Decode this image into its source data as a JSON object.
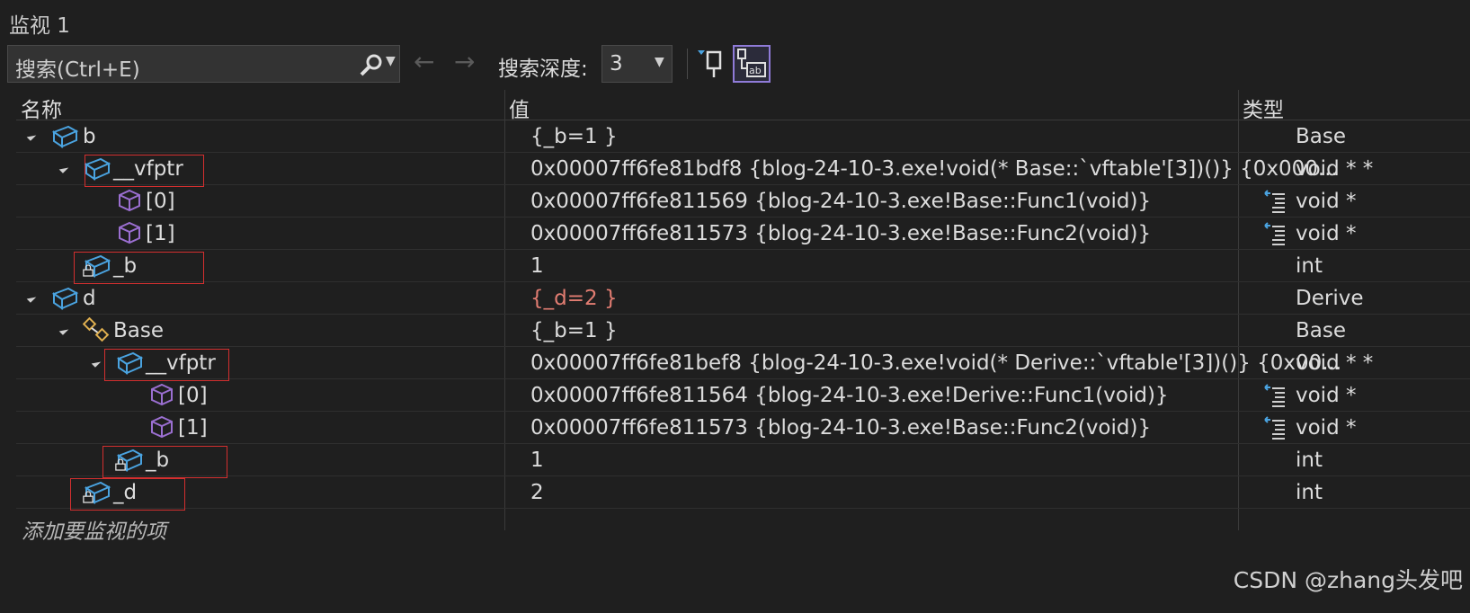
{
  "window": {
    "title": "监视 1"
  },
  "toolbar": {
    "search_placeholder": "搜索(Ctrl+E)",
    "depth_label": "搜索深度:",
    "depth_value": "3",
    "back_glyph": "←",
    "forward_glyph": "→"
  },
  "columns": {
    "name": "名称",
    "value": "值",
    "type": "类型"
  },
  "rows": [
    {
      "name": "b",
      "value": "{_b=1 }",
      "type": "Base"
    },
    {
      "name": "__vfptr",
      "value": "0x00007ff6fe81bdf8 {blog-24-10-3.exe!void(* Base::`vftable'[3])()} {0x000...",
      "type": "void * *"
    },
    {
      "name": "[0]",
      "value": "0x00007ff6fe811569 {blog-24-10-3.exe!Base::Func1(void)}",
      "type": "void *"
    },
    {
      "name": "[1]",
      "value": "0x00007ff6fe811573 {blog-24-10-3.exe!Base::Func2(void)}",
      "type": "void *"
    },
    {
      "name": "_b",
      "value": "1",
      "type": "int"
    },
    {
      "name": "d",
      "value": "{_d=2 }",
      "type": "Derive"
    },
    {
      "name": "Base",
      "value": "{_b=1 }",
      "type": "Base"
    },
    {
      "name": "__vfptr",
      "value": "0x00007ff6fe81bef8 {blog-24-10-3.exe!void(* Derive::`vftable'[3])()} {0x00...",
      "type": "void * *"
    },
    {
      "name": "[0]",
      "value": "0x00007ff6fe811564 {blog-24-10-3.exe!Derive::Func1(void)}",
      "type": "void *"
    },
    {
      "name": "[1]",
      "value": "0x00007ff6fe811573 {blog-24-10-3.exe!Base::Func2(void)}",
      "type": "void *"
    },
    {
      "name": "_b",
      "value": "1",
      "type": "int"
    },
    {
      "name": "_d",
      "value": "2",
      "type": "int"
    }
  ],
  "add_watch_placeholder": "添加要监视的项",
  "watermark": "CSDN @zhang头发吧",
  "colors": {
    "background": "#1f1f1f",
    "changed_value": "#e27d72",
    "highlight_box": "#d32f2f",
    "class_icon": "#4aa3e0",
    "method_icon": "#9b6fd1"
  },
  "icons": [
    "search-icon",
    "back-arrow-icon",
    "forward-arrow-icon",
    "pin-icon",
    "hex-display-icon",
    "class-icon",
    "method-icon",
    "base-class-icon",
    "lock-icon",
    "visualizer-icon"
  ]
}
